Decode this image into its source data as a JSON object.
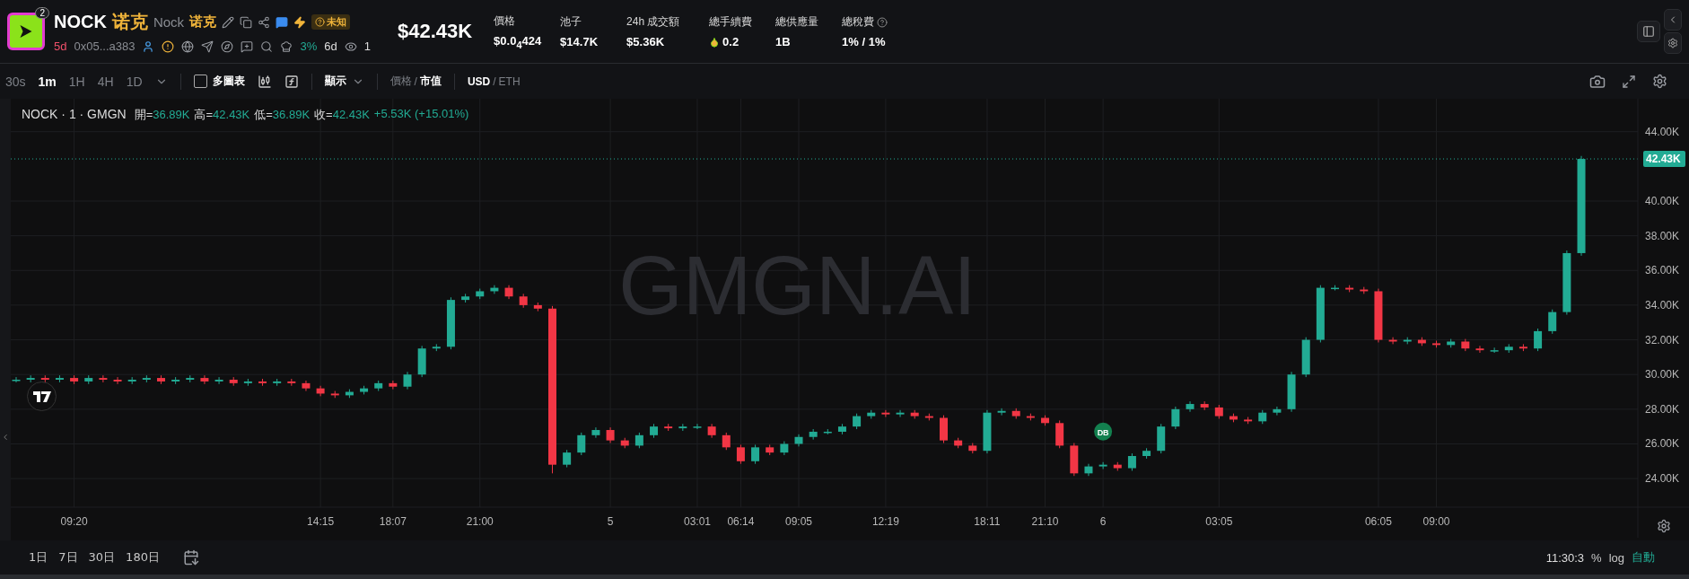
{
  "token": {
    "badge": "2",
    "symbol": "NOCK",
    "name_cn": "诺克",
    "name": "Nock",
    "name_cn_alt": "诺克",
    "tag": "未知",
    "age": "5d",
    "address": "0x05...a383",
    "holder_share": "3%",
    "holder_age": "6d",
    "watchers": "1",
    "price": "$42.43K"
  },
  "stats": [
    {
      "label": "價格",
      "value": "$0.0$_{4}$424",
      "kind": "plain"
    },
    {
      "label": "池子",
      "value": "$14.7K",
      "kind": "plain"
    },
    {
      "label": "24h 成交額",
      "value": "$5.36K",
      "kind": "plain"
    },
    {
      "label": "總手續費",
      "value": "0.2",
      "kind": "fee"
    },
    {
      "label": "總供應量",
      "value": "1B",
      "kind": "plain"
    },
    {
      "label": "總稅費",
      "value": "1% / 1%",
      "kind": "tax"
    }
  ],
  "intervals": [
    {
      "label": "30s",
      "selected": false
    },
    {
      "label": "1m",
      "selected": true
    },
    {
      "label": "1H",
      "selected": false
    },
    {
      "label": "4H",
      "selected": false
    },
    {
      "label": "1D",
      "selected": false
    }
  ],
  "multi_chart": {
    "label": "多圖表",
    "checked": false
  },
  "display": "顯示",
  "value_mode": {
    "separator": "/",
    "options": [
      {
        "label": "價格",
        "selected": false
      },
      {
        "label": "市值",
        "selected": true
      }
    ]
  },
  "currency": {
    "separator": "/",
    "options": [
      {
        "label": "USD",
        "selected": true
      },
      {
        "label": "ETH",
        "selected": false
      }
    ]
  },
  "legend": {
    "title": "NOCK · 1 · GMGN",
    "fields": [
      {
        "label": "開=",
        "value": "36.89K"
      },
      {
        "label": "高=",
        "value": "42.43K"
      },
      {
        "label": "低=",
        "value": "36.89K"
      },
      {
        "label": "收=",
        "value": "42.43K"
      }
    ],
    "change": "+5.53K (+15.01%)"
  },
  "watermark": "GMGN.AI",
  "chart_data": {
    "type": "candlestick",
    "grid": true,
    "ylim": [
      22.35,
      45.9
    ],
    "yticks": [
      {
        "value": 24,
        "label": "24.00K"
      },
      {
        "value": 26,
        "label": "26.00K"
      },
      {
        "value": 28,
        "label": "28.00K"
      },
      {
        "value": 30,
        "label": "30.00K"
      },
      {
        "value": 32,
        "label": "32.00K"
      },
      {
        "value": 34,
        "label": "34.00K"
      },
      {
        "value": 36,
        "label": "36.00K"
      },
      {
        "value": 38,
        "label": "38.00K"
      },
      {
        "value": 40,
        "label": "40.00K"
      },
      {
        "value": 44,
        "label": "44.00K"
      }
    ],
    "categories": [
      null,
      null,
      null,
      null,
      "09:20",
      null,
      null,
      null,
      null,
      null,
      null,
      null,
      null,
      null,
      null,
      null,
      null,
      null,
      null,
      null,
      null,
      "14:15",
      null,
      null,
      null,
      null,
      "18:07",
      null,
      null,
      null,
      null,
      null,
      "21:00",
      null,
      null,
      null,
      null,
      null,
      null,
      null,
      null,
      "5",
      null,
      null,
      null,
      null,
      null,
      "03:01",
      null,
      null,
      "06:14",
      null,
      null,
      null,
      "09:05",
      null,
      null,
      null,
      null,
      null,
      "12:19",
      null,
      null,
      null,
      null,
      null,
      null,
      "18:11",
      null,
      null,
      null,
      "21:10",
      null,
      null,
      null,
      "6",
      null,
      null,
      null,
      null,
      null,
      null,
      null,
      "03:05",
      null,
      null,
      null,
      null,
      null,
      null,
      null,
      null,
      null,
      null,
      "06:05",
      null,
      null,
      null,
      "09:00",
      null,
      null,
      null,
      null,
      null,
      null,
      null,
      null,
      null,
      null
    ],
    "ohlc": [
      [
        29.65,
        29.85,
        29.55,
        29.7
      ],
      [
        29.7,
        29.95,
        29.55,
        29.8
      ],
      [
        29.8,
        29.95,
        29.55,
        29.7
      ],
      [
        29.7,
        29.95,
        29.55,
        29.8
      ],
      [
        29.8,
        29.95,
        29.45,
        29.6
      ],
      [
        29.6,
        29.95,
        29.45,
        29.8
      ],
      [
        29.8,
        29.95,
        29.55,
        29.7
      ],
      [
        29.7,
        29.85,
        29.45,
        29.6
      ],
      [
        29.6,
        29.85,
        29.45,
        29.7
      ],
      [
        29.7,
        29.95,
        29.55,
        29.8
      ],
      [
        29.8,
        29.95,
        29.45,
        29.6
      ],
      [
        29.6,
        29.85,
        29.45,
        29.7
      ],
      [
        29.7,
        29.95,
        29.55,
        29.8
      ],
      [
        29.8,
        29.95,
        29.45,
        29.6
      ],
      [
        29.6,
        29.85,
        29.45,
        29.7
      ],
      [
        29.7,
        29.85,
        29.35,
        29.5
      ],
      [
        29.5,
        29.75,
        29.35,
        29.6
      ],
      [
        29.6,
        29.75,
        29.35,
        29.5
      ],
      [
        29.5,
        29.75,
        29.35,
        29.6
      ],
      [
        29.6,
        29.75,
        29.35,
        29.5
      ],
      [
        29.5,
        29.65,
        29.05,
        29.2
      ],
      [
        29.2,
        29.35,
        28.75,
        28.9
      ],
      [
        28.9,
        29.05,
        28.65,
        28.8
      ],
      [
        28.8,
        29.15,
        28.65,
        29.0
      ],
      [
        29.0,
        29.35,
        28.85,
        29.2
      ],
      [
        29.2,
        29.65,
        29.05,
        29.5
      ],
      [
        29.5,
        29.65,
        29.15,
        29.3
      ],
      [
        29.3,
        30.15,
        29.15,
        30.0
      ],
      [
        30.0,
        31.65,
        29.85,
        31.5
      ],
      [
        31.5,
        31.75,
        31.35,
        31.6
      ],
      [
        31.6,
        34.45,
        31.45,
        34.3
      ],
      [
        34.3,
        34.65,
        34.15,
        34.5
      ],
      [
        34.5,
        34.95,
        34.35,
        34.8
      ],
      [
        34.8,
        35.15,
        34.65,
        35.0
      ],
      [
        35.0,
        35.15,
        34.35,
        34.5
      ],
      [
        34.5,
        34.65,
        33.85,
        34.0
      ],
      [
        34.0,
        34.15,
        33.65,
        33.8
      ],
      [
        33.8,
        33.95,
        24.3,
        24.8
      ],
      [
        24.8,
        25.65,
        24.65,
        25.5
      ],
      [
        25.5,
        26.65,
        25.35,
        26.5
      ],
      [
        26.5,
        26.95,
        26.35,
        26.8
      ],
      [
        26.8,
        26.95,
        26.05,
        26.2
      ],
      [
        26.2,
        26.35,
        25.75,
        25.9
      ],
      [
        25.9,
        26.65,
        25.75,
        26.5
      ],
      [
        26.5,
        27.15,
        26.35,
        27.0
      ],
      [
        27.0,
        27.15,
        26.75,
        26.9
      ],
      [
        26.9,
        27.15,
        26.75,
        27.0
      ],
      [
        27.0,
        27.15,
        26.85,
        27.0
      ],
      [
        27.0,
        27.15,
        26.35,
        26.5
      ],
      [
        26.5,
        26.65,
        25.65,
        25.8
      ],
      [
        25.8,
        25.95,
        24.85,
        25.0
      ],
      [
        25.0,
        25.95,
        24.85,
        25.8
      ],
      [
        25.8,
        25.95,
        25.35,
        25.5
      ],
      [
        25.5,
        26.15,
        25.35,
        26.0
      ],
      [
        26.0,
        26.55,
        25.85,
        26.4
      ],
      [
        26.4,
        26.85,
        26.25,
        26.7
      ],
      [
        26.7,
        26.85,
        26.55,
        26.7
      ],
      [
        26.7,
        27.15,
        26.55,
        27.0
      ],
      [
        27.0,
        27.75,
        26.85,
        27.6
      ],
      [
        27.6,
        27.95,
        27.45,
        27.8
      ],
      [
        27.8,
        27.95,
        27.55,
        27.7
      ],
      [
        27.7,
        27.95,
        27.55,
        27.8
      ],
      [
        27.8,
        27.95,
        27.45,
        27.6
      ],
      [
        27.6,
        27.75,
        27.35,
        27.5
      ],
      [
        27.5,
        27.65,
        26.05,
        26.2
      ],
      [
        26.2,
        26.35,
        25.75,
        25.9
      ],
      [
        25.9,
        26.05,
        25.45,
        25.6
      ],
      [
        25.6,
        27.95,
        25.45,
        27.8
      ],
      [
        27.8,
        28.05,
        27.65,
        27.9
      ],
      [
        27.9,
        28.05,
        27.45,
        27.6
      ],
      [
        27.6,
        27.75,
        27.35,
        27.5
      ],
      [
        27.5,
        27.65,
        27.05,
        27.2
      ],
      [
        27.2,
        27.35,
        25.75,
        25.9
      ],
      [
        25.9,
        26.05,
        24.15,
        24.3
      ],
      [
        24.3,
        24.85,
        24.15,
        24.7
      ],
      [
        24.7,
        24.95,
        24.55,
        24.8
      ],
      [
        24.8,
        24.95,
        24.45,
        24.6
      ],
      [
        24.6,
        25.45,
        24.45,
        25.3
      ],
      [
        25.3,
        25.75,
        25.15,
        25.6
      ],
      [
        25.6,
        27.15,
        25.45,
        27.0
      ],
      [
        27.0,
        28.15,
        26.85,
        28.0
      ],
      [
        28.0,
        28.45,
        27.85,
        28.3
      ],
      [
        28.3,
        28.45,
        27.95,
        28.1
      ],
      [
        28.1,
        28.25,
        27.45,
        27.6
      ],
      [
        27.6,
        27.75,
        27.25,
        27.4
      ],
      [
        27.4,
        27.55,
        27.15,
        27.3
      ],
      [
        27.3,
        27.95,
        27.15,
        27.8
      ],
      [
        27.8,
        28.15,
        27.65,
        28.0
      ],
      [
        28.0,
        30.15,
        27.85,
        30.0
      ],
      [
        30.0,
        32.15,
        29.85,
        32.0
      ],
      [
        32.0,
        35.15,
        31.85,
        35.0
      ],
      [
        35.0,
        35.15,
        34.85,
        35.0
      ],
      [
        35.0,
        35.15,
        34.75,
        34.9
      ],
      [
        34.9,
        35.05,
        34.65,
        34.8
      ],
      [
        34.8,
        34.95,
        31.85,
        32.0
      ],
      [
        32.0,
        32.15,
        31.75,
        31.9
      ],
      [
        31.9,
        32.15,
        31.75,
        32.0
      ],
      [
        32.0,
        32.15,
        31.65,
        31.8
      ],
      [
        31.8,
        31.95,
        31.55,
        31.7
      ],
      [
        31.7,
        32.05,
        31.55,
        31.9
      ],
      [
        31.9,
        32.05,
        31.35,
        31.5
      ],
      [
        31.5,
        31.65,
        31.25,
        31.4
      ],
      [
        31.4,
        31.55,
        31.25,
        31.4
      ],
      [
        31.4,
        31.75,
        31.25,
        31.6
      ],
      [
        31.6,
        31.75,
        31.35,
        31.5
      ],
      [
        31.5,
        32.65,
        31.35,
        32.5
      ],
      [
        32.5,
        33.75,
        32.35,
        33.6
      ],
      [
        33.6,
        37.15,
        33.45,
        37.0
      ],
      [
        37.0,
        42.6,
        36.85,
        42.43
      ]
    ],
    "ref_lines": [
      {
        "axis": "y",
        "value": 42.43,
        "label": "42.43K",
        "color": "#22ab94"
      }
    ],
    "annotations": [
      "DB"
    ]
  },
  "ranges": [
    "1日",
    "7日",
    "30日",
    "180日"
  ],
  "clock": "11:30:3",
  "scale_options": [
    {
      "label": "%",
      "selected": false
    },
    {
      "label": "log",
      "selected": false
    },
    {
      "label": "自動",
      "selected": true
    }
  ]
}
